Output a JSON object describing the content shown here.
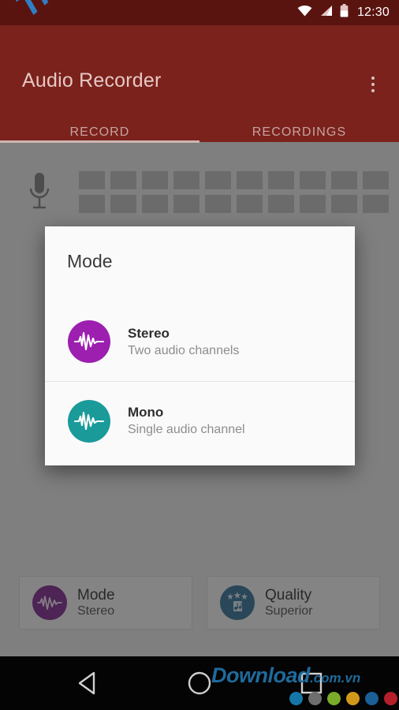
{
  "status_bar": {
    "time": "12:30",
    "icons": [
      "wifi-icon",
      "cellular-signal-icon",
      "battery-icon"
    ],
    "background": "#5a1410"
  },
  "app_bar": {
    "title": "Audio Recorder",
    "background": "#7b221c",
    "title_color": "#e6c8c5",
    "overflow_menu": "overflow-menu-icon",
    "tabs": [
      {
        "label": "RECORD",
        "selected": true
      },
      {
        "label": "RECORDINGS",
        "selected": false
      }
    ]
  },
  "background_screen": {
    "mic_icon": "microphone-icon",
    "level_meter": {
      "columns": 10,
      "rows": 2
    },
    "option_cards": [
      {
        "title": "Mode",
        "value": "Stereo",
        "icon": "waveform-icon",
        "badge_color": "#7a1f8c"
      },
      {
        "title": "Quality",
        "value": "Superior",
        "icon": "music-note-stars-icon",
        "badge_color": "#2a6e96"
      }
    ]
  },
  "dialog": {
    "title": "Mode",
    "background": "#fafafa",
    "options": [
      {
        "label": "Stereo",
        "description": "Two audio channels",
        "icon": "waveform-icon",
        "badge_color": "#9c1fb0"
      },
      {
        "label": "Mono",
        "description": "Single audio channel",
        "icon": "waveform-icon",
        "badge_color": "#1b9a9a"
      }
    ]
  },
  "nav_bar": {
    "background": "#040404",
    "buttons": [
      {
        "name": "back-button",
        "icon": "triangle-back-icon"
      },
      {
        "name": "home-button",
        "icon": "circle-home-icon"
      },
      {
        "name": "recents-button",
        "icon": "square-recents-icon"
      }
    ]
  },
  "watermarks": {
    "diagonal": {
      "text": "Truongtin.top",
      "top_color": "#d32020",
      "bottom_color": "#2f7fc4"
    },
    "bottom": {
      "main": "Download",
      "suffix": ".com.vn",
      "color": "#1f6a9c",
      "dots": [
        "#1477a8",
        "#6e6e6e",
        "#7aab2a",
        "#d1981a",
        "#1a5f96",
        "#b51f2a"
      ]
    }
  }
}
